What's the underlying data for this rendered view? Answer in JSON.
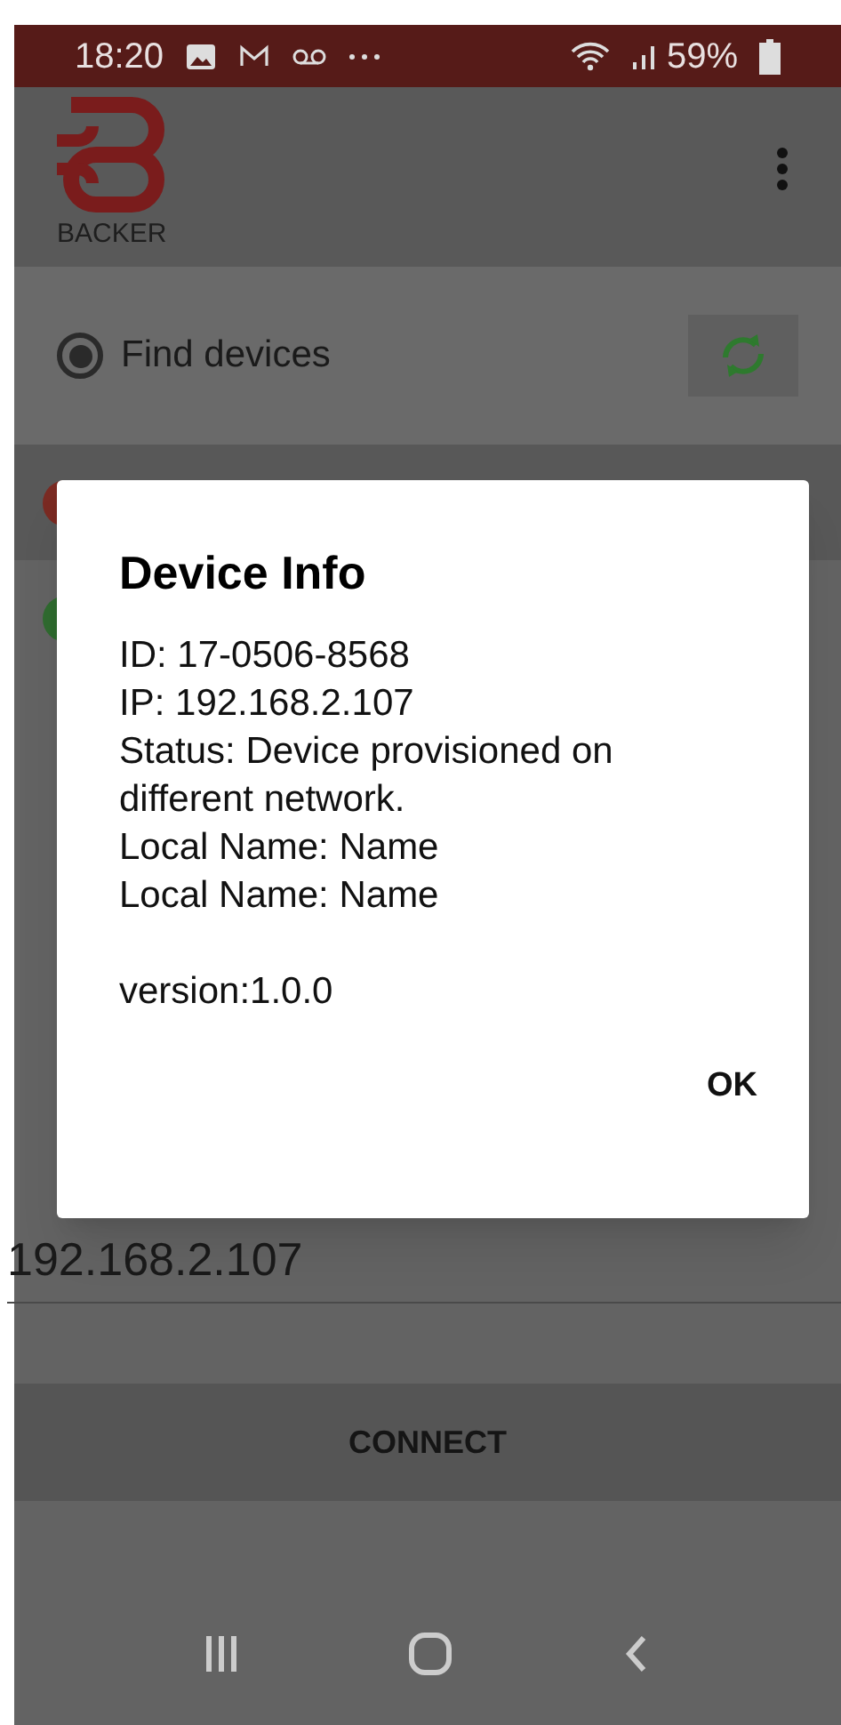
{
  "status_bar": {
    "time": "18:20",
    "battery": "59%"
  },
  "app_bar": {
    "logo_text": "BACKER"
  },
  "find": {
    "label": "Find devices",
    "selected": true
  },
  "devices": [
    {
      "color": "#7a2a22"
    },
    {
      "color": "#2f6b2f"
    }
  ],
  "ip_field": {
    "value": "192.168.2.107"
  },
  "connect_button": "CONNECT",
  "dialog": {
    "title": "Device Info",
    "lines": [
      "ID: 17-0506-8568",
      "IP: 192.168.2.107",
      "Status: Device provisioned on different network.",
      "Local Name: Name",
      "Local Name: Name"
    ],
    "version": "version:1.0.0",
    "ok": "OK"
  }
}
